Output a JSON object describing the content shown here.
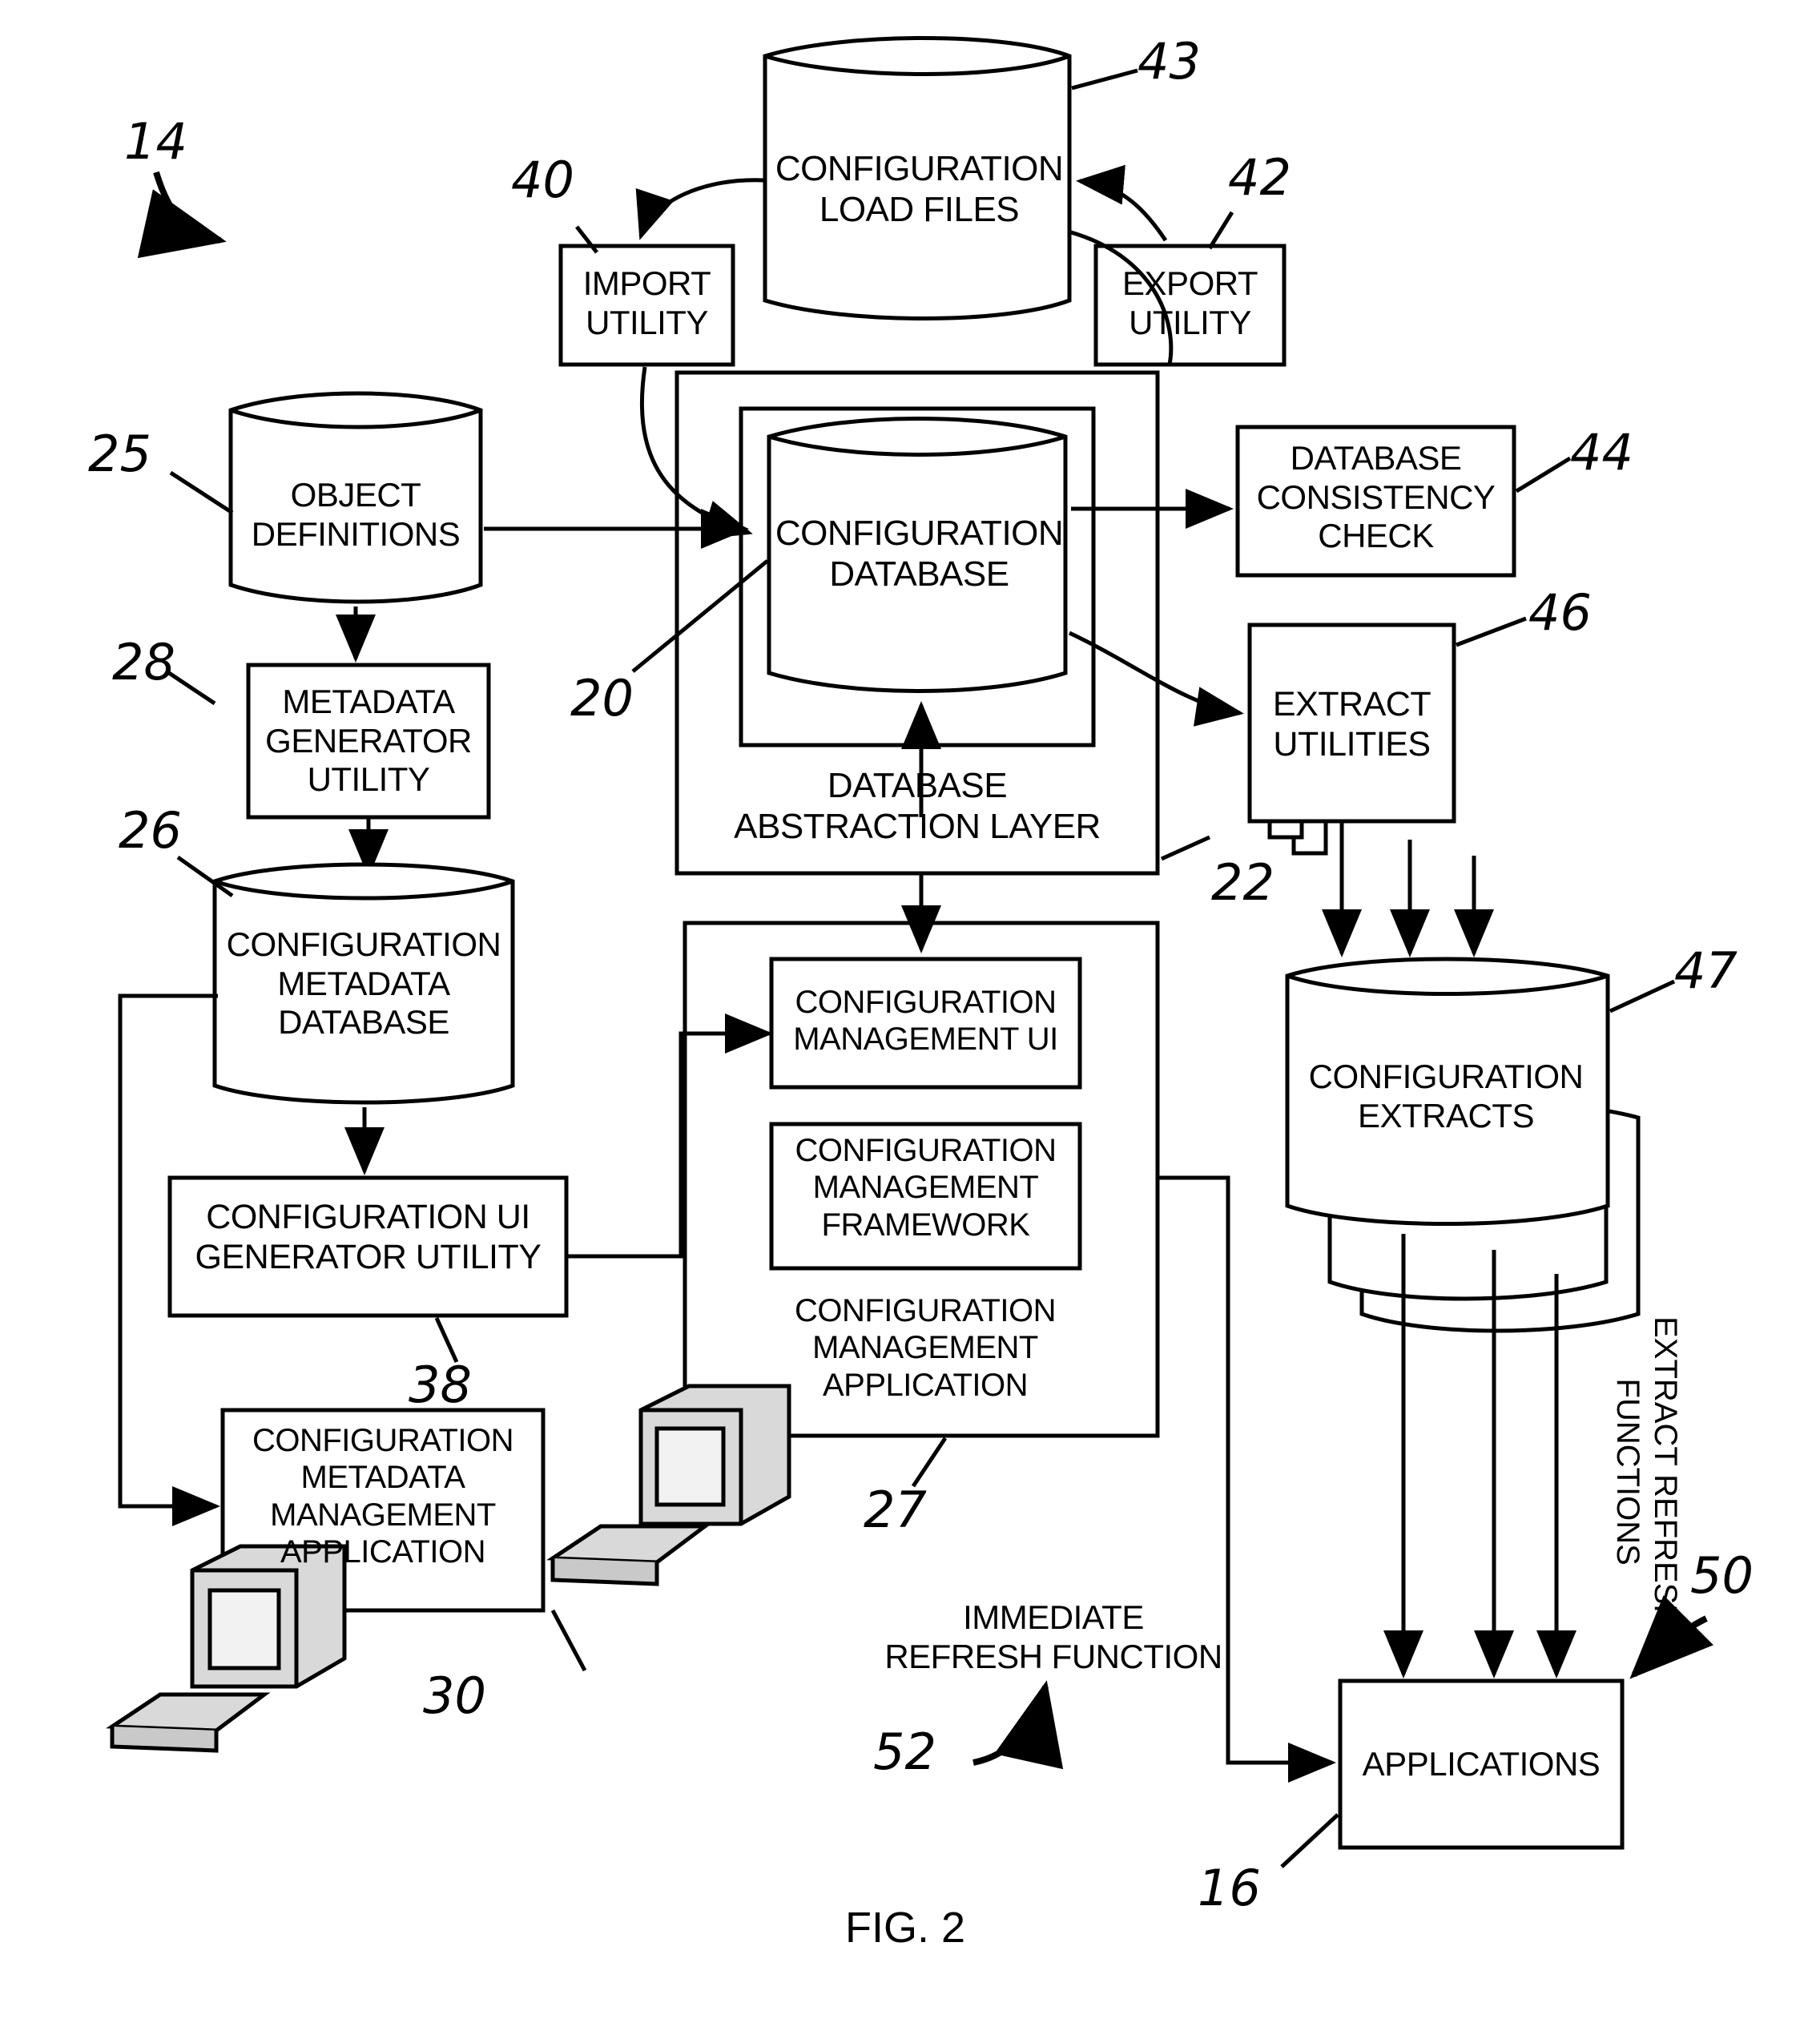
{
  "figure": {
    "caption": "FIG. 2",
    "system_ref": "14"
  },
  "nodes": {
    "config_load_files": {
      "label": "CONFIGURATION\nLOAD FILES",
      "ref": "43",
      "shape": "cylinder"
    },
    "import_utility": {
      "label": "IMPORT\nUTILITY",
      "ref": "40",
      "shape": "box"
    },
    "export_utility": {
      "label": "EXPORT\nUTILITY",
      "ref": "42",
      "shape": "box"
    },
    "object_definitions": {
      "label": "OBJECT\nDEFINITIONS",
      "ref": "25",
      "shape": "cylinder"
    },
    "metadata_generator_utility": {
      "label": "METADATA\nGENERATOR\nUTILITY",
      "ref": "28",
      "shape": "box"
    },
    "config_metadata_database": {
      "label": "CONFIGURATION\nMETADATA\nDATABASE",
      "ref": "26",
      "shape": "cylinder"
    },
    "config_ui_generator_utility": {
      "label": "CONFIGURATION UI\nGENERATOR UTILITY",
      "ref": "38",
      "shape": "box"
    },
    "config_metadata_mgmt_application": {
      "label": "CONFIGURATION\nMETADATA\nMANAGEMENT\nAPPLICATION",
      "ref": "30",
      "shape": "box"
    },
    "config_database": {
      "label": "CONFIGURATION\nDATABASE",
      "ref": "20",
      "shape": "cylinder"
    },
    "database_abstraction_layer": {
      "label": "DATABASE\nABSTRACTION LAYER",
      "ref": "22",
      "shape": "box"
    },
    "database_consistency_check": {
      "label": "DATABASE\nCONSISTENCY\nCHECK",
      "ref": "44",
      "shape": "box"
    },
    "extract_utilities": {
      "label": "EXTRACT\nUTILITIES",
      "ref": "46",
      "shape": "stacked-box"
    },
    "config_extracts": {
      "label": "CONFIGURATION\nEXTRACTS",
      "ref": "47",
      "shape": "stacked-cylinder"
    },
    "config_management_ui": {
      "label": "CONFIGURATION\nMANAGEMENT UI",
      "ref": "",
      "shape": "box"
    },
    "config_management_framework": {
      "label": "CONFIGURATION\nMANAGEMENT\nFRAMEWORK",
      "ref": "",
      "shape": "box"
    },
    "config_management_application": {
      "label": "CONFIGURATION\nMANAGEMENT\nAPPLICATION",
      "ref": "27",
      "shape": "box"
    },
    "applications": {
      "label": "APPLICATIONS",
      "ref": "16",
      "shape": "box"
    }
  },
  "annotations": {
    "extract_refresh_functions": {
      "label": "EXTRACT REFRESH\nFUNCTIONS",
      "ref": "50"
    },
    "immediate_refresh_function": {
      "label": "IMMEDIATE\nREFRESH FUNCTION",
      "ref": "52"
    }
  },
  "style": {
    "line_color": "#000000",
    "background": "#ffffff",
    "monitor_fill": "#d9d9d9"
  }
}
